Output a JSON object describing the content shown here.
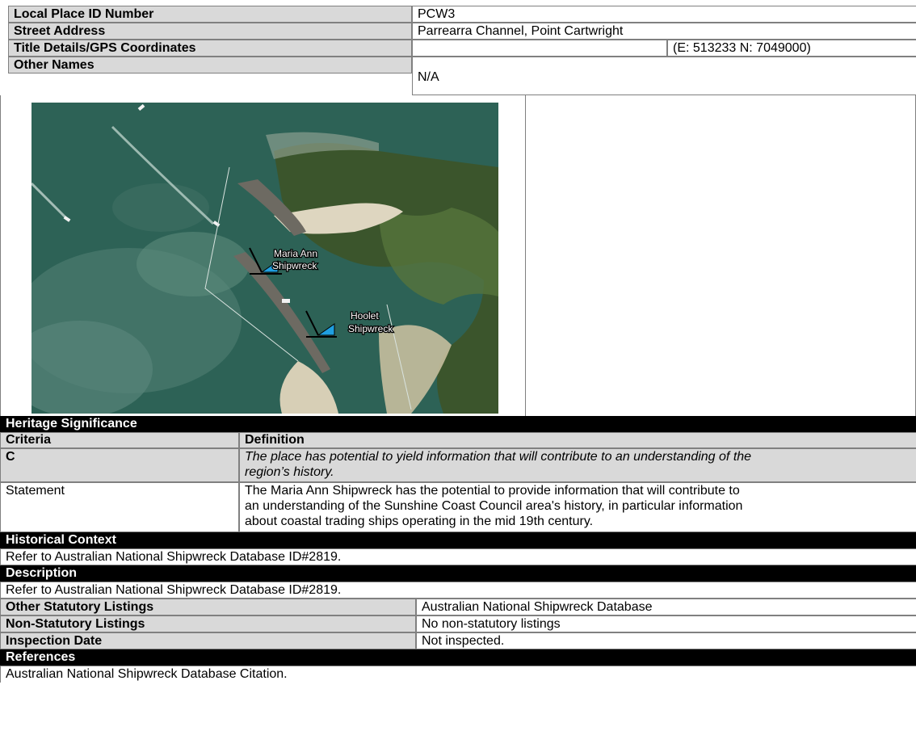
{
  "place_info": {
    "id_label": "Local Place ID Number",
    "id_value": "PCW3",
    "address_label": "Street Address",
    "address_value": "Parrearra Channel, Point Cartwright",
    "title_label": "Title Details/GPS Coordinates",
    "title_value": "",
    "gps_value": "(E: 513233 N: 7049000)",
    "other_names_label": "Other Names",
    "other_names_value": "N/A"
  },
  "map": {
    "label_maria_line1": "Maria Ann",
    "label_maria_line2": "Shipwreck",
    "label_hoolet_line1": "Hoolet",
    "label_hoolet_line2": "Shipwreck",
    "colors": {
      "sea": "#2c6156",
      "shallow": "#5f8e82",
      "sand": "#d8d0b8",
      "vegetation": "#3e5a30",
      "marker": "#1f9fe0"
    }
  },
  "heritage": {
    "section_title": "Heritage Significance",
    "criteria_header": "Criteria",
    "definition_header": "Definition",
    "criterion_code": "C",
    "criterion_line1": "The place has potential to yield information that will contribute to an understanding of the",
    "criterion_line2": "region’s history.",
    "statement_label": "Statement",
    "statement_line1": "The Maria Ann Shipwreck has the potential to provide information that will contribute to",
    "statement_line2": "an understanding of the Sunshine Coast Council area's history, in particular information",
    "statement_line3": "about coastal trading ships operating in the mid 19th century."
  },
  "historical_context": {
    "title": "Historical Context",
    "text": "Refer to Australian National Shipwreck Database ID#2819."
  },
  "description": {
    "title": "Description",
    "text": "Refer to Australian National Shipwreck Database ID#2819."
  },
  "listings": {
    "statutory_label": "Other Statutory Listings",
    "statutory_value": "Australian National Shipwreck Database",
    "non_statutory_label": "Non-Statutory Listings",
    "non_statutory_value": "No non-statutory listings",
    "inspection_label": "Inspection Date",
    "inspection_value": "Not inspected."
  },
  "references": {
    "title": "References",
    "text": "Australian National Shipwreck Database Citation."
  }
}
